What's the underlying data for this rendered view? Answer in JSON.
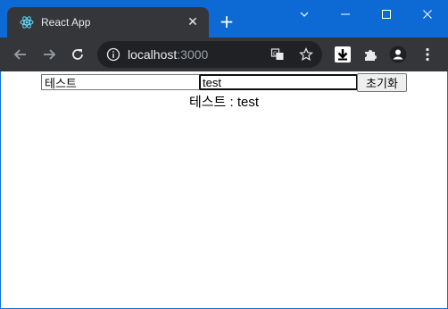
{
  "browser": {
    "tab_title": "React App",
    "tab_close": "✕",
    "new_tab": "+",
    "url_host": "localhost",
    "url_port": ":3000",
    "window_controls": {
      "dropdown": "⌄",
      "minimize": "—",
      "maximize": "☐",
      "close": "✕"
    }
  },
  "icons": {
    "tab_favicon": "react-icon",
    "back": "back-arrow-icon",
    "forward": "forward-arrow-icon",
    "reload": "reload-icon",
    "site_info": "info-icon",
    "translate": "translate-icon",
    "bookmark": "star-icon",
    "download": "download-extension-icon",
    "extensions": "puzzle-icon",
    "profile": "profile-icon",
    "menu": "kebab-menu-icon"
  },
  "page": {
    "name_input_value": "테스트",
    "text_input_value": "test",
    "reset_button_label": "초기화",
    "result_text": "테스트 : test"
  }
}
